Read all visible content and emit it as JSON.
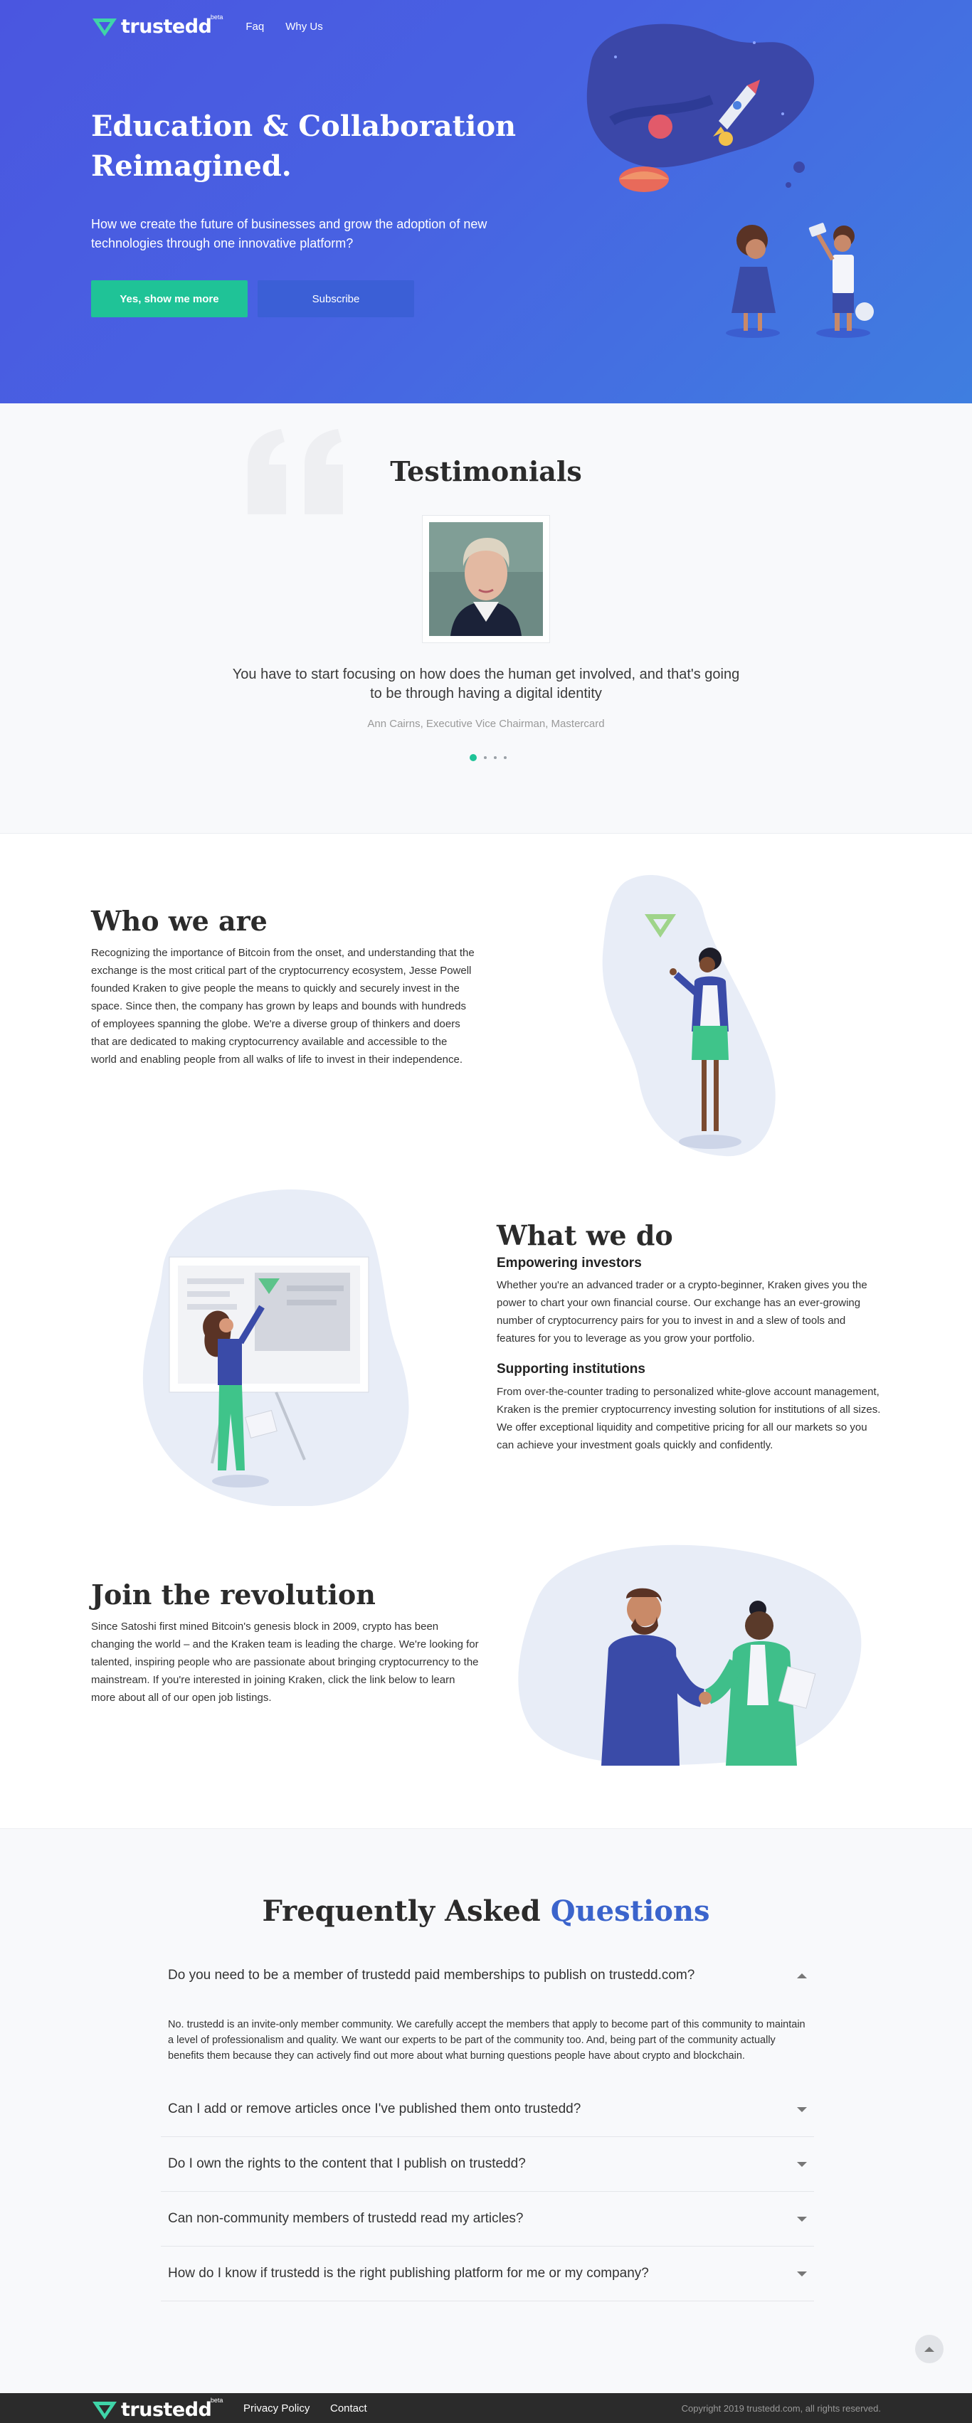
{
  "brand": {
    "name": "trustedd",
    "badge": "beta"
  },
  "nav": {
    "items": [
      "Faq",
      "Why Us"
    ]
  },
  "hero": {
    "title": "Education & Collaboration Reimagined.",
    "subtitle": "How we create the future of businesses and grow the adoption of new technologies through one innovative platform?",
    "primary_button": "Yes, show me more",
    "secondary_button": "Subscribe"
  },
  "testimonials": {
    "title": "Testimonials",
    "quote": "You have to start focusing on how does the human get involved, and that's going to be through having a digital identity",
    "author": "Ann Cairns, Executive Vice Chairman, Mastercard",
    "slides": 4,
    "active_slide": 1
  },
  "who": {
    "title": "Who we are",
    "text": "Recognizing the importance of Bitcoin from the onset, and understanding that the exchange is the most critical part of the cryptocurrency ecosystem, Jesse Powell founded Kraken to give people the means to quickly and securely invest in the space. Since then, the company has grown by leaps and bounds with hundreds of employees spanning the globe. We're a diverse group of thinkers and doers that are dedicated to making cryptocurrency available and accessible to the world and enabling people from all walks of life to invest in their independence."
  },
  "what": {
    "title": "What we do",
    "sub1": "Empowering investors",
    "text1": "Whether you're an advanced trader or a crypto-beginner, Kraken gives you the power to chart your own financial course. Our exchange has an ever-growing number of cryptocurrency pairs for you to invest in and a slew of tools and features for you to leverage as you grow your portfolio.",
    "sub2": "Supporting institutions",
    "text2": "From over-the-counter trading to personalized white-glove account management, Kraken is the premier cryptocurrency investing solution for institutions of all sizes. We offer exceptional liquidity and competitive pricing for all our markets so you can achieve your investment goals quickly and confidently."
  },
  "join": {
    "title": "Join the revolution",
    "text": "Since Satoshi first mined Bitcoin's genesis block in 2009, crypto has been changing the world – and the Kraken team is leading the charge. We're looking for talented, inspiring people who are passionate about bringing cryptocurrency to the mainstream. If you're interested in joining Kraken, click the link below to learn more about all of our open job listings."
  },
  "faq": {
    "title_main": "Frequently Asked",
    "title_accent": "Questions",
    "items": [
      {
        "q": "Do you need to be a member of trustedd paid memberships to publish on trustedd.com?",
        "a": "No. trustedd is an invite-only member community. We carefully accept the members that apply to become part of this community to maintain a level of professionalism and quality. We want our experts to be part of the community too. And, being part of the community actually benefits them because they can actively find out more about what burning questions people have about crypto and blockchain."
      },
      {
        "q": "Can I add or remove articles once I've published them onto trustedd?"
      },
      {
        "q": "Do I own the rights to the content that I publish on trustedd?"
      },
      {
        "q": "Can non-community members of trustedd read my articles?"
      },
      {
        "q": "How do I know if trustedd is the right publishing platform for me or my company?"
      }
    ]
  },
  "footer": {
    "links": [
      "Privacy Policy",
      "Contact"
    ],
    "copyright": "Copyright 2019 trustedd.com, all rights reserved."
  },
  "colors": {
    "accent_green": "#1fc397",
    "hero_blue": "#4a56e0",
    "accent_blue": "#3b64cc",
    "footer_bg": "#2b2b2b"
  },
  "icons": [
    "logo-mark-icon",
    "quote-icon",
    "caret-up-icon",
    "caret-down-icon",
    "arrow-up-icon"
  ]
}
